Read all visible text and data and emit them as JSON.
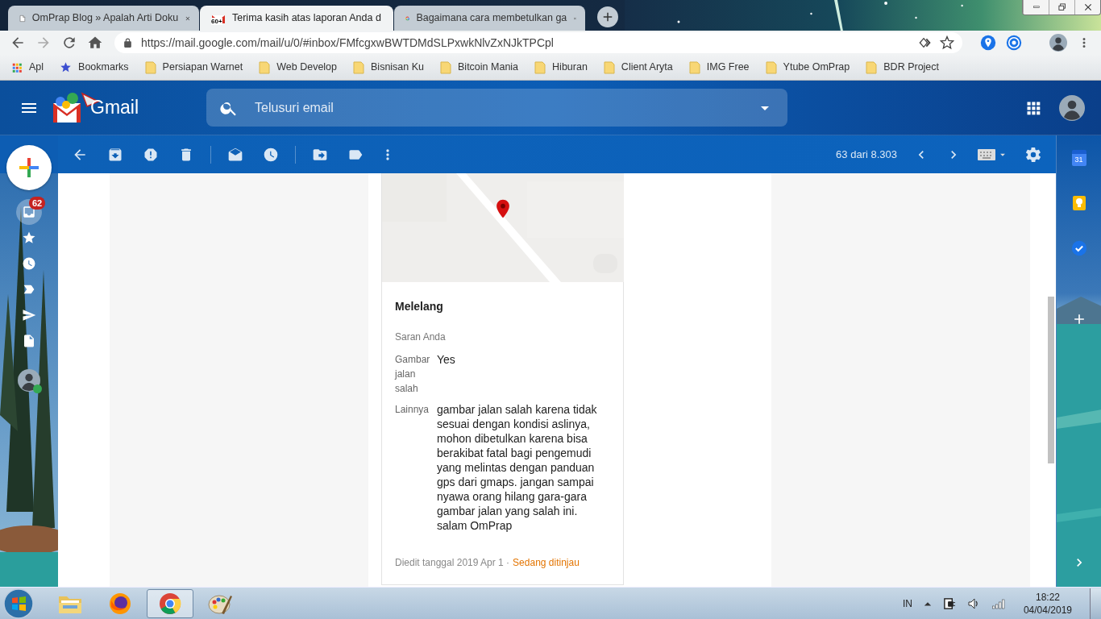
{
  "browser": {
    "tabs": [
      {
        "title": "OmPrap Blog » Apalah Arti Doku",
        "selected": false
      },
      {
        "favicon_text": "60+",
        "title": "Terima kasih atas laporan Anda d",
        "selected": true
      },
      {
        "title": "Bagaimana cara membetulkan ga",
        "selected": false
      }
    ],
    "url": "https://mail.google.com/mail/u/0/#inbox/FMfcgxwBWTDMdSLPxwkNlvZxNJkTPCpl",
    "bookmarks": [
      {
        "kind": "apps",
        "label": "Apl"
      },
      {
        "kind": "star",
        "label": "Bookmarks"
      },
      {
        "kind": "folder",
        "label": "Persiapan Warnet"
      },
      {
        "kind": "folder",
        "label": "Web Develop"
      },
      {
        "kind": "folder",
        "label": "Bisnisan Ku"
      },
      {
        "kind": "folder",
        "label": "Bitcoin Mania"
      },
      {
        "kind": "folder",
        "label": "Hiburan"
      },
      {
        "kind": "folder",
        "label": "Client Aryta"
      },
      {
        "kind": "folder",
        "label": "IMG Free"
      },
      {
        "kind": "folder",
        "label": "Ytube OmPrap"
      },
      {
        "kind": "folder",
        "label": "BDR Project"
      }
    ]
  },
  "gmail": {
    "logo": "Gmail",
    "search": {
      "placeholder": "Telusuri email"
    },
    "page_count": "63 dari 8.303",
    "nav": [
      {
        "kind": "inbox",
        "badge": "62",
        "selected": true
      },
      {
        "kind": "star",
        "selected": false
      },
      {
        "kind": "snoozed",
        "selected": false
      },
      {
        "kind": "important",
        "selected": false
      },
      {
        "kind": "sent",
        "selected": false
      },
      {
        "kind": "drafts",
        "selected": false
      }
    ],
    "calendar_day": "31"
  },
  "report": {
    "title": "Melelang",
    "section": "Saran Anda",
    "fields": [
      {
        "label": "Gambar jalan salah",
        "value": "Yes"
      },
      {
        "label": "Lainnya",
        "value": "gambar jalan salah karena tidak sesuai dengan kondisi aslinya, mohon dibetulkan karena bisa berakibat fatal bagi pengemudi yang melintas dengan panduan gps dari gmaps. jangan sampai nyawa orang hilang gara-gara gambar jalan yang salah ini. salam OmPrap"
      }
    ],
    "footer": "Diedit tanggal 2019 Apr 1 ·",
    "status": "Sedang ditinjau"
  },
  "taskbar": {
    "apps": [
      {
        "kind": "explorer",
        "selected": false
      },
      {
        "kind": "firefox",
        "selected": false
      },
      {
        "kind": "chrome",
        "selected": true
      },
      {
        "kind": "paint",
        "selected": false
      }
    ],
    "language": "IN",
    "time": "18:22",
    "date": "04/04/2019"
  }
}
